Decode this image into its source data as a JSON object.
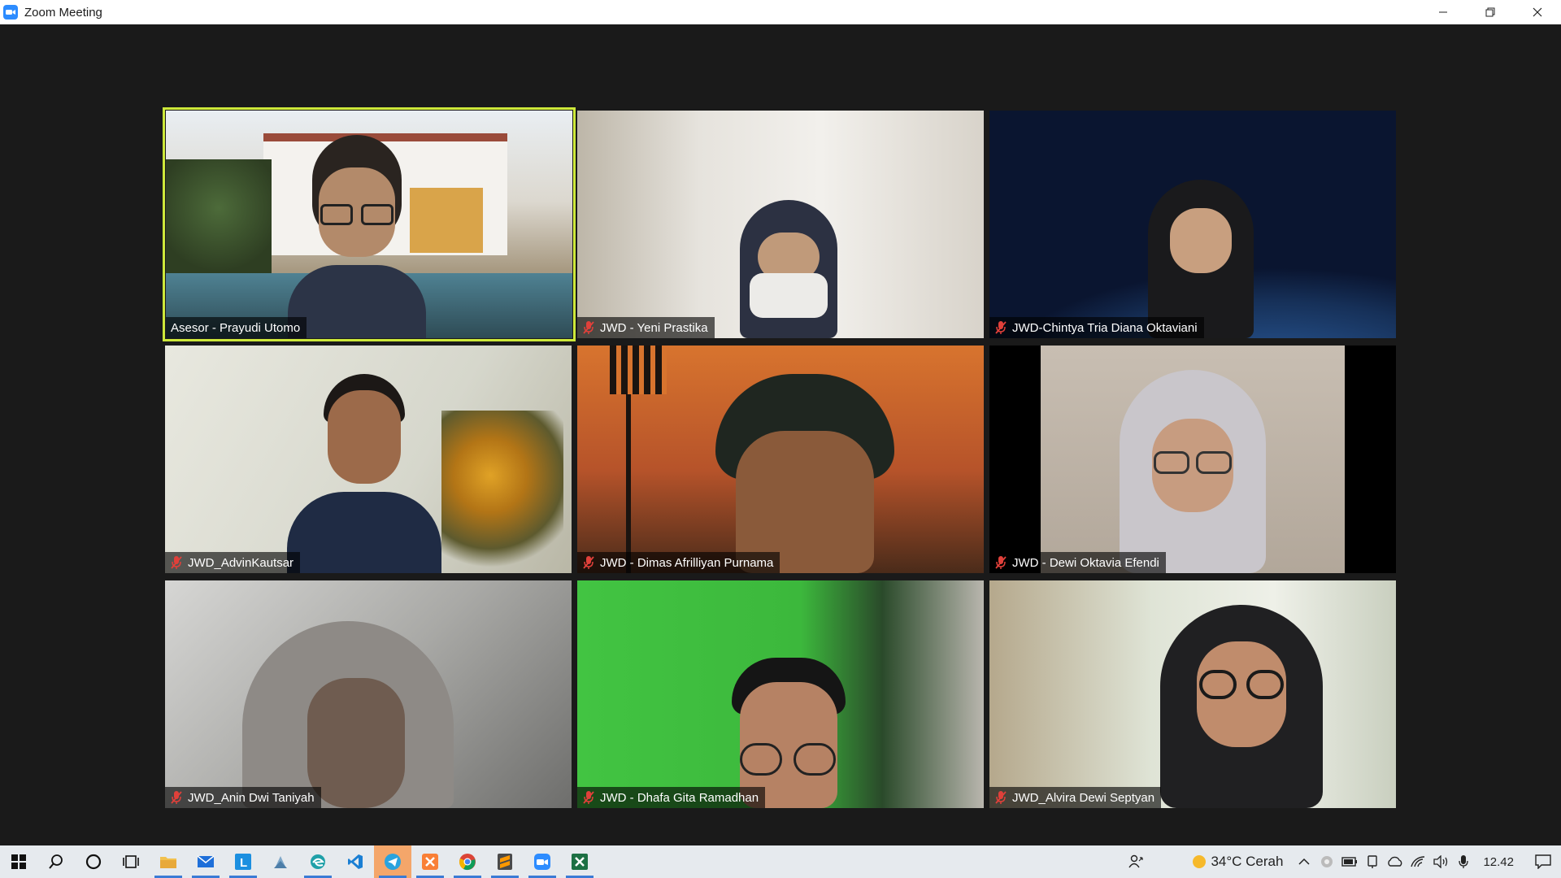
{
  "window": {
    "title": "Zoom Meeting"
  },
  "participants": [
    {
      "name": "Asesor - Prayudi Utomo",
      "muted": false,
      "active_speaker": true,
      "bg": "#c9c2b4"
    },
    {
      "name": "JWD - Yeni Prastika",
      "muted": true,
      "active_speaker": false,
      "bg": "#d8d4cc"
    },
    {
      "name": "JWD-Chintya Tria Diana Oktaviani",
      "muted": true,
      "active_speaker": false,
      "bg": "#0d1a33"
    },
    {
      "name": "JWD_AdvinKautsar",
      "muted": true,
      "active_speaker": false,
      "bg": "#d9d9cc"
    },
    {
      "name": "JWD - Dimas Afrilliyan Purnama",
      "muted": true,
      "active_speaker": false,
      "bg": "#c4642d"
    },
    {
      "name": "JWD - Dewi Oktavia Efendi",
      "muted": true,
      "active_speaker": false,
      "bg": "#b4aaa0"
    },
    {
      "name": "JWD_Anin Dwi Taniyah",
      "muted": true,
      "active_speaker": false,
      "bg": "#9a9a98"
    },
    {
      "name": "JWD - Dhafa Gita Ramadhan",
      "muted": true,
      "active_speaker": false,
      "bg": "#3ec23e"
    },
    {
      "name": "JWD_Alvira Dewi Septyan",
      "muted": true,
      "active_speaker": false,
      "bg": "#cfd6c4"
    }
  ],
  "taskbar": {
    "apps": [
      "start-icon",
      "search-icon",
      "cortana-icon",
      "task-view-icon",
      "file-explorer-icon",
      "mail-icon",
      "app-l-icon",
      "app-stack-icon",
      "edge-icon",
      "vscode-icon",
      "telegram-icon",
      "xampp-icon",
      "chrome-icon",
      "sublime-icon",
      "zoom-icon",
      "excel-icon"
    ],
    "weather": "34°C  Cerah",
    "clock": "12.42"
  },
  "colors": {
    "active_speaker_border": "#cde83a",
    "muted_icon": "#e0403a",
    "zoom_blue": "#2d8cff"
  }
}
